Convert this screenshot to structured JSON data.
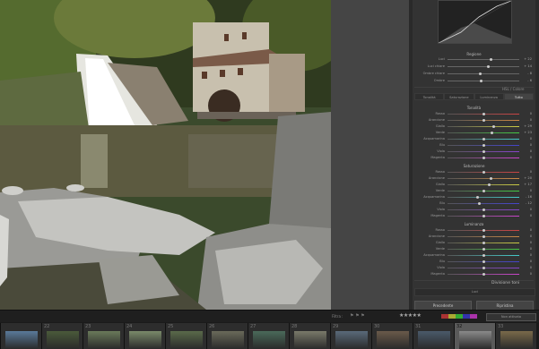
{
  "panel": {
    "tone_title": "Regione",
    "tone_rows": [
      {
        "label": "Luci",
        "value": "+ 22"
      },
      {
        "label": "Luci chiare",
        "value": "+ 14"
      },
      {
        "label": "Ombre chiare",
        "value": "- 8"
      },
      {
        "label": "Ombre",
        "value": "- 6"
      }
    ],
    "hsl_header": "HSL / Colore",
    "tabs": [
      "Tonalità",
      "Saturazione",
      "Luminanza",
      "Tutto"
    ],
    "group_hue": "Tonalità",
    "group_sat": "Saturazione",
    "group_lum": "Luminanza",
    "rows": [
      {
        "label": "Rosso",
        "value": "0"
      },
      {
        "label": "Arancione",
        "value": "0"
      },
      {
        "label": "Giallo",
        "value": "+ 29"
      },
      {
        "label": "Verde",
        "value": "+ 23"
      },
      {
        "label": "Acquamarina",
        "value": "0"
      },
      {
        "label": "Blu",
        "value": "0"
      },
      {
        "label": "Viola",
        "value": "0"
      },
      {
        "label": "Magenta",
        "value": "0"
      }
    ],
    "sat_rows": [
      {
        "label": "Rosso",
        "value": "0"
      },
      {
        "label": "Arancione",
        "value": "+ 20"
      },
      {
        "label": "Giallo",
        "value": "+ 17"
      },
      {
        "label": "Verde",
        "value": "0"
      },
      {
        "label": "Acquamarina",
        "value": "- 16"
      },
      {
        "label": "Blu",
        "value": "- 12"
      },
      {
        "label": "Viola",
        "value": "0"
      },
      {
        "label": "Magenta",
        "value": "0"
      }
    ],
    "lum_rows": [
      {
        "label": "Rosso",
        "value": "0"
      },
      {
        "label": "Arancione",
        "value": "0"
      },
      {
        "label": "Giallo",
        "value": "0"
      },
      {
        "label": "Verde",
        "value": "0"
      },
      {
        "label": "Acquamarina",
        "value": "0"
      },
      {
        "label": "Blu",
        "value": "0"
      },
      {
        "label": "Viola",
        "value": "0"
      },
      {
        "label": "Magenta",
        "value": "0"
      }
    ],
    "split_toning": "Divisione toni",
    "split_value": "Luci",
    "btn_prev": "Precedente",
    "btn_reset": "Ripristina"
  },
  "filmbar": {
    "filter_label": "Filtra :",
    "filter_value": "Non attivato"
  },
  "filmstrip": {
    "numbers": [
      "",
      "22",
      "23",
      "24",
      "25",
      "26",
      "27",
      "28",
      "29",
      "30",
      "31",
      "32",
      "33"
    ]
  }
}
